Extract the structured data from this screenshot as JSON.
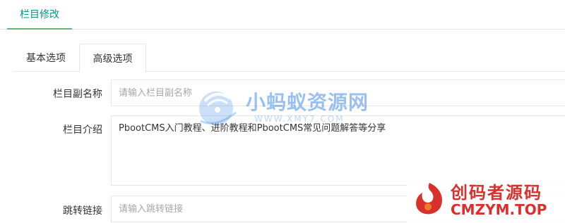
{
  "header": {
    "tab_label": "栏目修改"
  },
  "subtabs": {
    "basic_label": "基本选项",
    "advanced_label": "高级选项"
  },
  "form": {
    "subname": {
      "label": "栏目副名称",
      "value": "",
      "placeholder": "请输入栏目副名称"
    },
    "intro": {
      "label": "栏目介绍",
      "value": "PbootCMS入门教程、进阶教程和PbootCMS常见问题解答等分享"
    },
    "link": {
      "label": "跳转链接",
      "value": "",
      "placeholder": "请输入跳转链接"
    }
  },
  "watermarks": {
    "ant": {
      "text": "小蚂蚁资源网",
      "sub": "WWW.XMY7.COM"
    },
    "cmzym": {
      "text_cn": "创码者源码",
      "text_en": "CMZYM.TOP"
    }
  },
  "colors": {
    "accent": "#009688",
    "tab_underline": "#5fb878",
    "border": "#e6e6e6",
    "watermark_blue": "#468ce6",
    "watermark_red": "#d9302c"
  }
}
